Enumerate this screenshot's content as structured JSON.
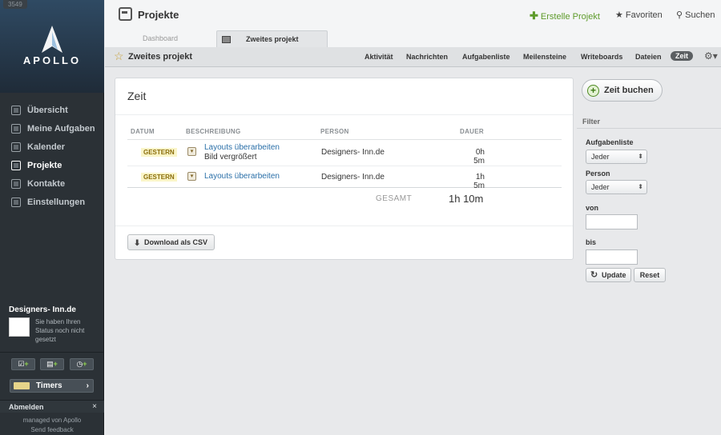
{
  "sidebar": {
    "counter": "3549",
    "logo_text": "APOLLO",
    "nav": [
      {
        "label": "Übersicht",
        "icon": "overview-icon"
      },
      {
        "label": "Meine Aufgaben",
        "icon": "tasks-icon"
      },
      {
        "label": "Kalender",
        "icon": "calendar-icon"
      },
      {
        "label": "Projekte",
        "icon": "projects-icon"
      },
      {
        "label": "Kontakte",
        "icon": "contacts-icon"
      },
      {
        "label": "Einstellungen",
        "icon": "settings-icon"
      }
    ],
    "active_nav": "Projekte",
    "user_name": "Designers- Inn.de",
    "user_status": "Sie haben Ihren Status noch nicht gesetzt",
    "timers_label": "Timers",
    "logout_label": "Abmelden",
    "footer_managed": "managed von Apollo",
    "footer_feedback": "Send feedback"
  },
  "topbar": {
    "title": "Projekte",
    "create_project": "Erstelle Projekt",
    "favorites": "Favoriten",
    "search": "Suchen"
  },
  "tabs": {
    "dashboard": "Dashboard",
    "current": "Zweites projekt"
  },
  "subnav": {
    "project_title": "Zweites projekt",
    "items": [
      "Aktivität",
      "Nachrichten",
      "Aufgabenliste",
      "Meilensteine",
      "Writeboards",
      "Dateien",
      "Zeit"
    ],
    "active": "Zeit"
  },
  "main": {
    "title": "Zeit",
    "columns": [
      "DATUM",
      "BESCHREIBUNG",
      "PERSON",
      "DAUER"
    ],
    "rows": [
      {
        "date": "GESTERN",
        "task": "Layouts überarbeiten",
        "note": "Bild vergrößert",
        "person": "Designers- Inn.de",
        "duration": "0h 5m"
      },
      {
        "date": "GESTERN",
        "task": "Layouts überarbeiten",
        "note": "",
        "person": "Designers- Inn.de",
        "duration": "1h 5m"
      }
    ],
    "total_label": "GESAMT",
    "total_value": "1h 10m",
    "csv_button": "Download als CSV"
  },
  "panel": {
    "book_button": "Zeit buchen",
    "filter_label": "Filter",
    "aufgabenliste_label": "Aufgabenliste",
    "aufgabenliste_value": "Jeder",
    "person_label": "Person",
    "person_value": "Jeder",
    "von_label": "von",
    "bis_label": "bis",
    "update_button": "Update",
    "reset_button": "Reset"
  },
  "colors": {
    "sidebar_bg": "#2b3136",
    "accent_green": "#5e9b2b",
    "link_blue": "#2a6fa8"
  }
}
